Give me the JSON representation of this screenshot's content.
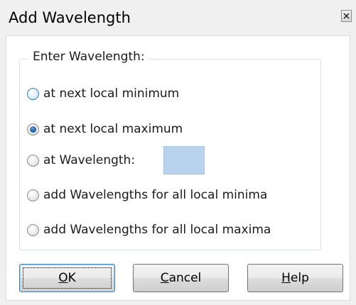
{
  "window": {
    "title": "Add Wavelength"
  },
  "group": {
    "legend": "Enter Wavelength:"
  },
  "options": [
    {
      "label": "at next local minimum",
      "selected": false
    },
    {
      "label": "at next local maximum",
      "selected": true
    },
    {
      "label": "at Wavelength:",
      "selected": false
    },
    {
      "label": "add Wavelengths for all local minima",
      "selected": false
    },
    {
      "label": "add Wavelengths for all local maxima",
      "selected": false
    }
  ],
  "wavelength_input": {
    "value": ""
  },
  "buttons": {
    "ok": {
      "access": "O",
      "rest": "K"
    },
    "cancel": {
      "access": "C",
      "rest": "ancel"
    },
    "help": {
      "access": "H",
      "rest": "elp"
    }
  },
  "colors": {
    "input_fill": "#b9d3ef",
    "radio_dot": "#1f5d9c",
    "default_button_border": "#3c7fb1"
  },
  "icons": {
    "close": "close-icon"
  }
}
